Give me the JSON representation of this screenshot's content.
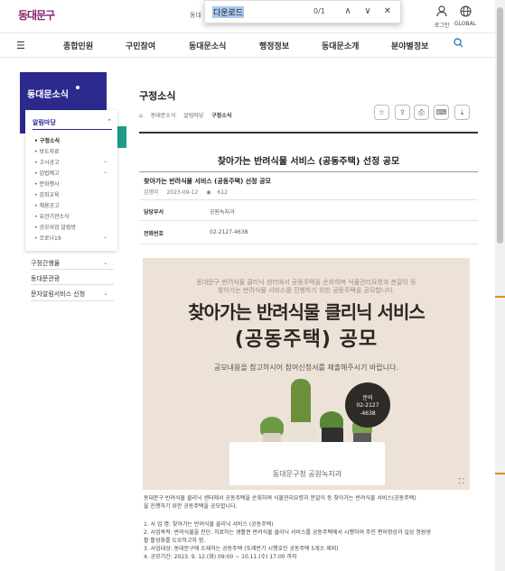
{
  "header": {
    "logo": "동대문구",
    "search_label": "동대",
    "find": {
      "query": "다운로드",
      "count": "0/1",
      "prev": "∧",
      "next": "∨",
      "close": "✕"
    },
    "login_label": "로그인",
    "global_label": "GLOBAL"
  },
  "nav": {
    "items": [
      "종합민원",
      "구민참여",
      "동대문소식",
      "행정정보",
      "동대문소개",
      "분야별정보"
    ]
  },
  "sidebar": {
    "title": "동대문소식",
    "category": "알림마당",
    "sub_items": [
      {
        "label": "• 구정소식",
        "active": true
      },
      {
        "label": "• 보도자료"
      },
      {
        "label": "• 고시공고"
      },
      {
        "label": "• 입법예고"
      },
      {
        "label": "• 문화행사"
      },
      {
        "label": "• 강좌교육"
      },
      {
        "label": "• 채용공고"
      },
      {
        "label": "• 유관기관소식"
      },
      {
        "label": "• 공모사업 알림방"
      },
      {
        "label": "• 코로나19"
      }
    ],
    "links": [
      "구정간행물",
      "동대문관광",
      "문자알림서비스 신청"
    ]
  },
  "page": {
    "title": "구정소식",
    "breadcrumb": [
      "⌂",
      "동대문소식",
      "알림마당",
      "구정소식"
    ],
    "tools": [
      "☆",
      "⇪",
      "⎙",
      "⌨",
      "⤓"
    ]
  },
  "post": {
    "title": "찾아가는 반려식물 서비스 (공동주택) 선정 공모",
    "subtitle": "찾아가는 반려식물 서비스 (공동주택) 선정 공모",
    "author": "김영미",
    "date": "2023-09-12",
    "views": "612",
    "dept_label": "담당부서",
    "dept_value": "공원녹지과",
    "phone_label": "전화번호",
    "phone_value": "02-2127-4638"
  },
  "poster": {
    "small_line1": "동대문구 반려식물 클리닉 센터에서 공동주택을 순회하며 식물관리요령과 분갈이 등",
    "small_line2": "찾아가는 반려식물 서비스를 진행하기 위한 공동주택을 공모합니다.",
    "title1": "찾아가는 반려식물 클리닉 서비스",
    "title2": "(공동주택) 공모",
    "line": "공모내용을 참고하시어 참여신청서를 제출해주시기 바랍니다.",
    "bubble_line1": "문의",
    "bubble_line2": "02-2127",
    "bubble_line3": "-4638",
    "footer": "동대문구청 공원녹지과"
  },
  "body": {
    "intro1": "동대문구 반려식물 클리닉 센터에서 공동주택을 순회하며 식물관리요령과 분갈이 등 찾아가는 반려식물 서비스(공동주택)",
    "intro2": "을 진행하기 위한 공동주택을 공모합니다.",
    "list": [
      "1. 사 업 명: 찾아가는 반려식물 클리닉 서비스 (공동주택)",
      "2. 사업목적: 반려식물을 진단, 치료하는 생활권 반려식물 클리닉 서비스를 공동주택에서 시행하여 주민 편의향상과 일상 정원생",
      "활 활성화를 도모하고자 함.",
      "3. 사업대상: 동대문구에 소재하는 공동주택 (또래반기 시행호인 공동주택 5개소 제외)",
      "4. 공모기간: 2023. 9. 12.(화) 09:00 ~ 10.11.(수) 17:00 까지"
    ]
  }
}
